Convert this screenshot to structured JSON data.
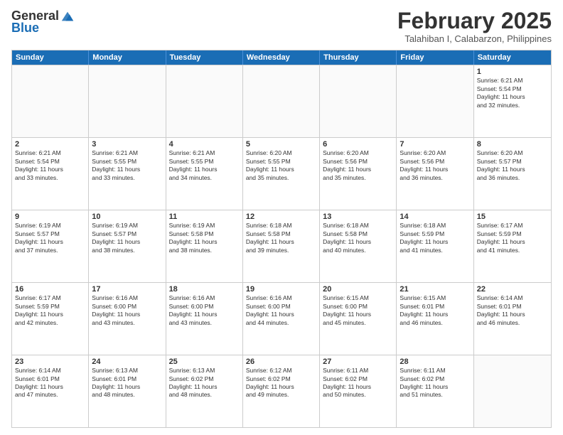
{
  "logo": {
    "general": "General",
    "blue": "Blue"
  },
  "title": "February 2025",
  "subtitle": "Talahiban I, Calabarzon, Philippines",
  "header_days": [
    "Sunday",
    "Monday",
    "Tuesday",
    "Wednesday",
    "Thursday",
    "Friday",
    "Saturday"
  ],
  "weeks": [
    [
      {
        "day": "",
        "info": ""
      },
      {
        "day": "",
        "info": ""
      },
      {
        "day": "",
        "info": ""
      },
      {
        "day": "",
        "info": ""
      },
      {
        "day": "",
        "info": ""
      },
      {
        "day": "",
        "info": ""
      },
      {
        "day": "1",
        "info": "Sunrise: 6:21 AM\nSunset: 5:54 PM\nDaylight: 11 hours\nand 32 minutes."
      }
    ],
    [
      {
        "day": "2",
        "info": "Sunrise: 6:21 AM\nSunset: 5:54 PM\nDaylight: 11 hours\nand 33 minutes."
      },
      {
        "day": "3",
        "info": "Sunrise: 6:21 AM\nSunset: 5:55 PM\nDaylight: 11 hours\nand 33 minutes."
      },
      {
        "day": "4",
        "info": "Sunrise: 6:21 AM\nSunset: 5:55 PM\nDaylight: 11 hours\nand 34 minutes."
      },
      {
        "day": "5",
        "info": "Sunrise: 6:20 AM\nSunset: 5:55 PM\nDaylight: 11 hours\nand 35 minutes."
      },
      {
        "day": "6",
        "info": "Sunrise: 6:20 AM\nSunset: 5:56 PM\nDaylight: 11 hours\nand 35 minutes."
      },
      {
        "day": "7",
        "info": "Sunrise: 6:20 AM\nSunset: 5:56 PM\nDaylight: 11 hours\nand 36 minutes."
      },
      {
        "day": "8",
        "info": "Sunrise: 6:20 AM\nSunset: 5:57 PM\nDaylight: 11 hours\nand 36 minutes."
      }
    ],
    [
      {
        "day": "9",
        "info": "Sunrise: 6:19 AM\nSunset: 5:57 PM\nDaylight: 11 hours\nand 37 minutes."
      },
      {
        "day": "10",
        "info": "Sunrise: 6:19 AM\nSunset: 5:57 PM\nDaylight: 11 hours\nand 38 minutes."
      },
      {
        "day": "11",
        "info": "Sunrise: 6:19 AM\nSunset: 5:58 PM\nDaylight: 11 hours\nand 38 minutes."
      },
      {
        "day": "12",
        "info": "Sunrise: 6:18 AM\nSunset: 5:58 PM\nDaylight: 11 hours\nand 39 minutes."
      },
      {
        "day": "13",
        "info": "Sunrise: 6:18 AM\nSunset: 5:58 PM\nDaylight: 11 hours\nand 40 minutes."
      },
      {
        "day": "14",
        "info": "Sunrise: 6:18 AM\nSunset: 5:59 PM\nDaylight: 11 hours\nand 41 minutes."
      },
      {
        "day": "15",
        "info": "Sunrise: 6:17 AM\nSunset: 5:59 PM\nDaylight: 11 hours\nand 41 minutes."
      }
    ],
    [
      {
        "day": "16",
        "info": "Sunrise: 6:17 AM\nSunset: 5:59 PM\nDaylight: 11 hours\nand 42 minutes."
      },
      {
        "day": "17",
        "info": "Sunrise: 6:16 AM\nSunset: 6:00 PM\nDaylight: 11 hours\nand 43 minutes."
      },
      {
        "day": "18",
        "info": "Sunrise: 6:16 AM\nSunset: 6:00 PM\nDaylight: 11 hours\nand 43 minutes."
      },
      {
        "day": "19",
        "info": "Sunrise: 6:16 AM\nSunset: 6:00 PM\nDaylight: 11 hours\nand 44 minutes."
      },
      {
        "day": "20",
        "info": "Sunrise: 6:15 AM\nSunset: 6:00 PM\nDaylight: 11 hours\nand 45 minutes."
      },
      {
        "day": "21",
        "info": "Sunrise: 6:15 AM\nSunset: 6:01 PM\nDaylight: 11 hours\nand 46 minutes."
      },
      {
        "day": "22",
        "info": "Sunrise: 6:14 AM\nSunset: 6:01 PM\nDaylight: 11 hours\nand 46 minutes."
      }
    ],
    [
      {
        "day": "23",
        "info": "Sunrise: 6:14 AM\nSunset: 6:01 PM\nDaylight: 11 hours\nand 47 minutes."
      },
      {
        "day": "24",
        "info": "Sunrise: 6:13 AM\nSunset: 6:01 PM\nDaylight: 11 hours\nand 48 minutes."
      },
      {
        "day": "25",
        "info": "Sunrise: 6:13 AM\nSunset: 6:02 PM\nDaylight: 11 hours\nand 48 minutes."
      },
      {
        "day": "26",
        "info": "Sunrise: 6:12 AM\nSunset: 6:02 PM\nDaylight: 11 hours\nand 49 minutes."
      },
      {
        "day": "27",
        "info": "Sunrise: 6:11 AM\nSunset: 6:02 PM\nDaylight: 11 hours\nand 50 minutes."
      },
      {
        "day": "28",
        "info": "Sunrise: 6:11 AM\nSunset: 6:02 PM\nDaylight: 11 hours\nand 51 minutes."
      },
      {
        "day": "",
        "info": ""
      }
    ]
  ]
}
